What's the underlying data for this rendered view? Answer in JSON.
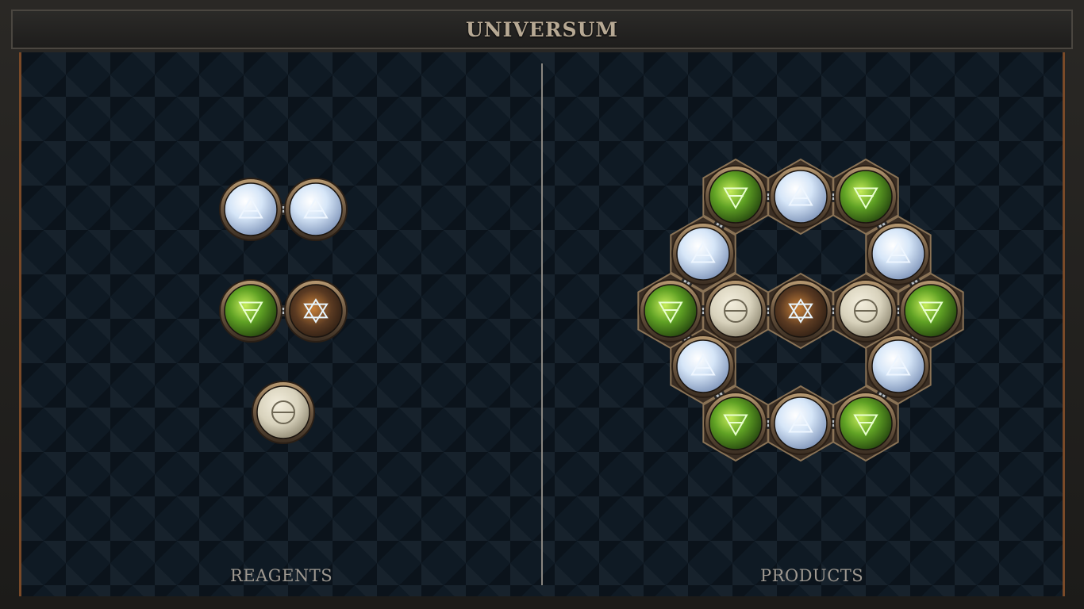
{
  "header": {
    "title": "UNIVERSUM"
  },
  "panels": {
    "reagents_label": "REAGENTS",
    "products_label": "PRODUCTS"
  },
  "colors": {
    "air": "#cfe2f7",
    "earth": "#5fa124",
    "water_fire": "#5a3a22",
    "salt": "#d8d2bc",
    "brass": "#8a7356"
  },
  "reagents": [
    {
      "atoms": [
        "air",
        "air"
      ],
      "bonds": [
        [
          0,
          1
        ]
      ]
    },
    {
      "atoms": [
        "earth",
        "fire-water"
      ],
      "bonds": [
        [
          0,
          1
        ]
      ]
    },
    {
      "atoms": [
        "salt"
      ],
      "bonds": []
    }
  ],
  "product": {
    "atoms": [
      "earth",
      "air",
      "earth",
      "air",
      "air",
      "earth",
      "salt",
      "fire-water",
      "salt",
      "earth",
      "air",
      "air",
      "earth",
      "air",
      "earth"
    ],
    "bond_count": 17
  }
}
